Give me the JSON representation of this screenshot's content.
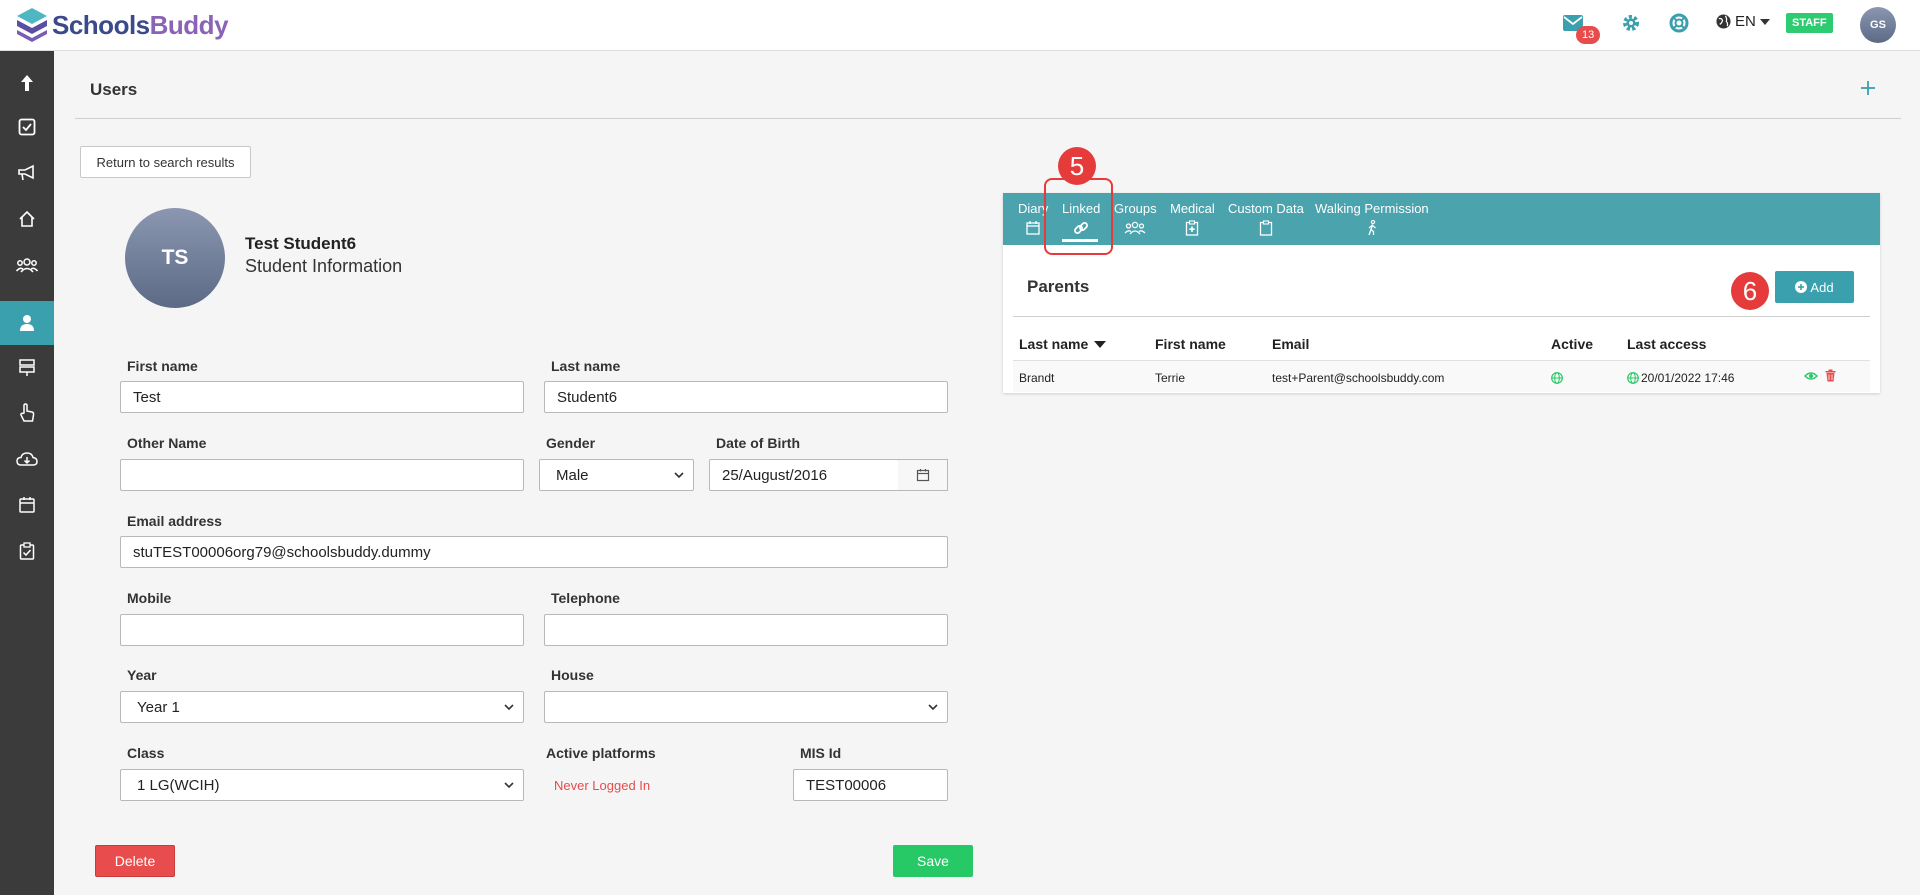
{
  "header": {
    "logo_part1": "Schools",
    "logo_part2": "Buddy",
    "mail_count": "13",
    "language": "EN",
    "role_badge": "STAFF",
    "user_initials": "GS"
  },
  "page": {
    "title": "Users",
    "return_button": "Return to search results"
  },
  "profile": {
    "initials": "TS",
    "name": "Test Student6",
    "subtitle": "Student Information"
  },
  "form": {
    "first_name_label": "First name",
    "first_name_value": "Test",
    "last_name_label": "Last name",
    "last_name_value": "Student6",
    "other_name_label": "Other Name",
    "other_name_value": "",
    "gender_label": "Gender",
    "gender_value": "Male",
    "dob_label": "Date of Birth",
    "dob_value": "25/August/2016",
    "email_label": "Email address",
    "email_value": "stuTEST00006org79@schoolsbuddy.dummy",
    "mobile_label": "Mobile",
    "mobile_value": "",
    "telephone_label": "Telephone",
    "telephone_value": "",
    "year_label": "Year",
    "year_value": "Year 1",
    "house_label": "House",
    "house_value": "",
    "class_label": "Class",
    "class_value": "1 LG(WCIH)",
    "platforms_label": "Active platforms",
    "platforms_value": "Never Logged In",
    "mis_label": "MIS Id",
    "mis_value": "TEST00006",
    "delete_button": "Delete",
    "save_button": "Save"
  },
  "panel": {
    "tabs": [
      {
        "label": "Diary"
      },
      {
        "label": "Linked"
      },
      {
        "label": "Groups"
      },
      {
        "label": "Medical"
      },
      {
        "label": "Custom Data"
      },
      {
        "label": "Walking Permission"
      }
    ],
    "active_tab": "Linked",
    "title": "Parents",
    "add_button": "Add",
    "columns": [
      "Last name",
      "First name",
      "Email",
      "Active",
      "Last access"
    ],
    "rows": [
      {
        "last_name": "Brandt",
        "first_name": "Terrie",
        "email": "test+Parent@schoolsbuddy.com",
        "last_access": "20/01/2022 17:46"
      }
    ]
  },
  "annotations": {
    "step_a": "5",
    "step_b": "6"
  },
  "colors": {
    "teal": "#3aa0ae",
    "tabbar": "#4aa3ad",
    "danger": "#e84c4c",
    "success": "#27c866",
    "sidebar": "#3b3b3b"
  }
}
